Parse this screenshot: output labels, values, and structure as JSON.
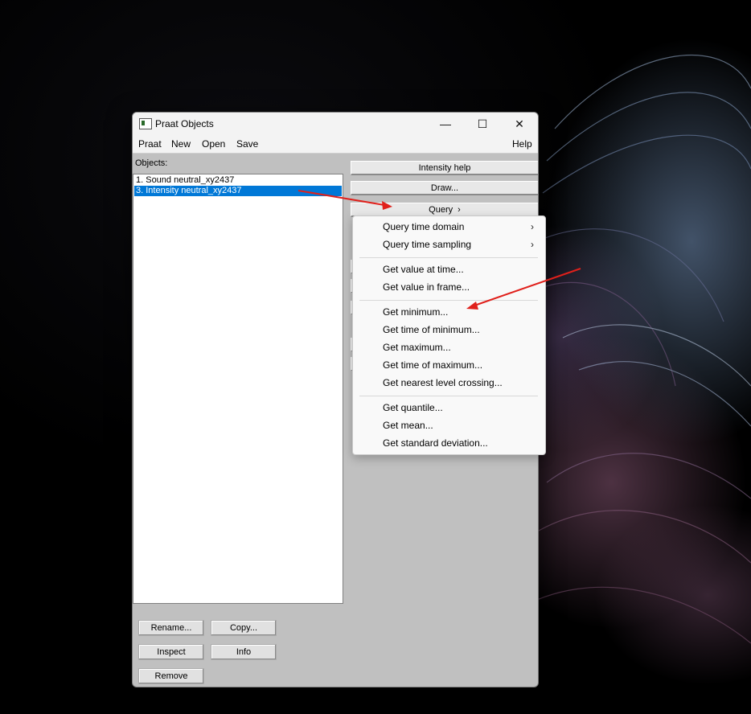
{
  "window": {
    "title": "Praat Objects",
    "controls": {
      "minimize": "—",
      "maximize": "☐",
      "close": "✕"
    }
  },
  "menubar": {
    "items": [
      "Praat",
      "New",
      "Open",
      "Save"
    ],
    "help": "Help"
  },
  "objects": {
    "label": "Objects:",
    "items": [
      "1. Sound neutral_xy2437",
      "3. Intensity neutral_xy2437"
    ],
    "selected_index": 1
  },
  "right_panel": {
    "intensity_help": "Intensity help",
    "draw": "Draw...",
    "query": "Query",
    "query_chevron": "›"
  },
  "bottom_buttons": {
    "rename": "Rename...",
    "copy": "Copy...",
    "inspect": "Inspect",
    "info": "Info",
    "remove": "Remove"
  },
  "query_menu": {
    "submenu_arrow": "›",
    "group1": [
      "Query time domain",
      "Query time sampling"
    ],
    "group2": [
      "Get value at time...",
      "Get value in frame..."
    ],
    "group3": [
      "Get minimum...",
      "Get time of minimum...",
      "Get maximum...",
      "Get time of maximum...",
      "Get nearest level crossing..."
    ],
    "group4": [
      "Get quantile...",
      "Get mean...",
      "Get standard deviation..."
    ]
  },
  "colors": {
    "selection": "#0078d7",
    "annotation_arrow": "#e0201b",
    "window_bg": "#c0c0c0"
  }
}
